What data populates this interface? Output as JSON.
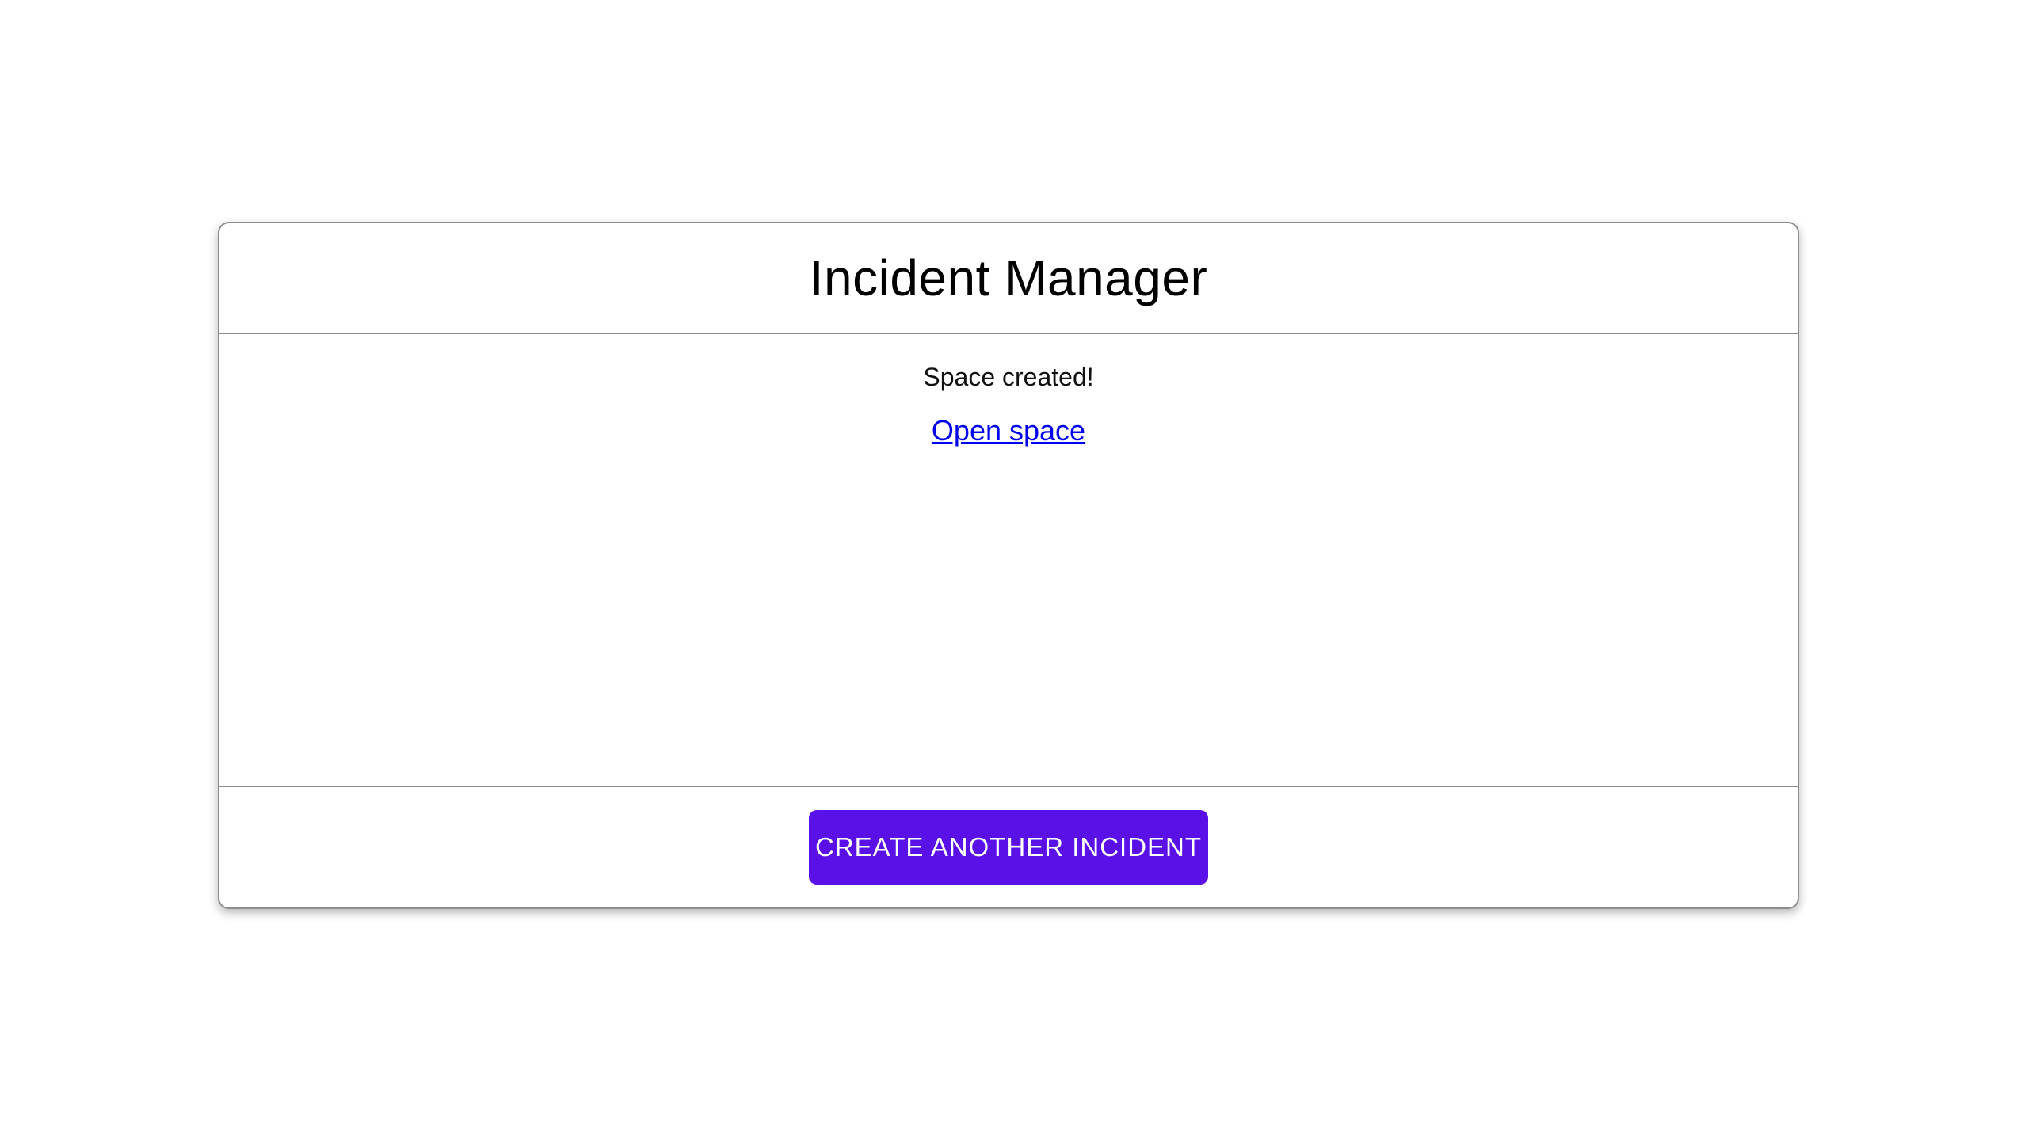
{
  "card": {
    "title": "Incident Manager",
    "body": {
      "status_message": "Space created!",
      "open_space_link_label": "Open space"
    },
    "footer": {
      "create_incident_button_label": "CREATE ANOTHER INCIDENT"
    }
  },
  "colors": {
    "button_background": "#5a11e8",
    "button_text": "#ffffff",
    "link": "#0000ee",
    "card_border": "#8d8d8d",
    "title_text": "#000000",
    "body_text": "#111111"
  }
}
